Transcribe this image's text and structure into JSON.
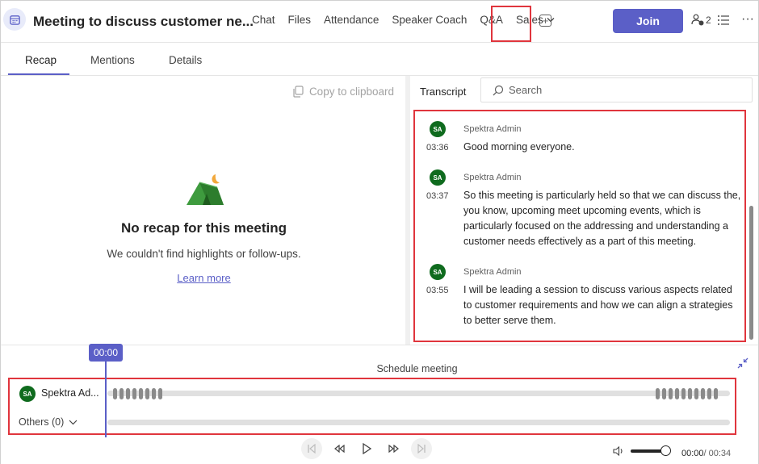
{
  "header": {
    "title": "Meeting to discuss customer ne...",
    "tabs": [
      "Chat",
      "Files",
      "Attendance",
      "Speaker Coach",
      "Q&A",
      "Sales"
    ],
    "join_label": "Join",
    "participant_count": "2"
  },
  "subtabs": [
    "Recap",
    "Mentions",
    "Details"
  ],
  "recap": {
    "copy_label": "Copy to clipboard",
    "empty_title": "No recap for this meeting",
    "empty_subtitle": "We couldn't find highlights or follow-ups.",
    "learn_more": "Learn more"
  },
  "transcript": {
    "label": "Transcript",
    "search_placeholder": "Search",
    "entries": [
      {
        "initials": "SA",
        "speaker": "Spektra Admin",
        "time": "03:36",
        "text": "Good morning everyone."
      },
      {
        "initials": "SA",
        "speaker": "Spektra Admin",
        "time": "03:37",
        "text": "So this meeting is particularly held so that we can discuss the, you know, upcoming meet upcoming events, which is particularly focused on the addressing and understanding a customer needs effectively as a part of this meeting."
      },
      {
        "initials": "SA",
        "speaker": "Spektra Admin",
        "time": "03:55",
        "text": "I will be leading a session to discuss various aspects related to customer requirements and how we can align a strategies to better serve them."
      }
    ]
  },
  "timeline": {
    "playhead_time": "00:00",
    "schedule_label": "Schedule meeting",
    "speaker_initials": "SA",
    "speaker_name": "Spektra Ad...",
    "others_label": "Others (0)",
    "current_time": "00:00",
    "duration": "/ 00:34"
  },
  "colors": {
    "accent": "#5b5fc7",
    "highlight_border": "#e0353d",
    "avatar_bg": "#0f6b1e"
  }
}
